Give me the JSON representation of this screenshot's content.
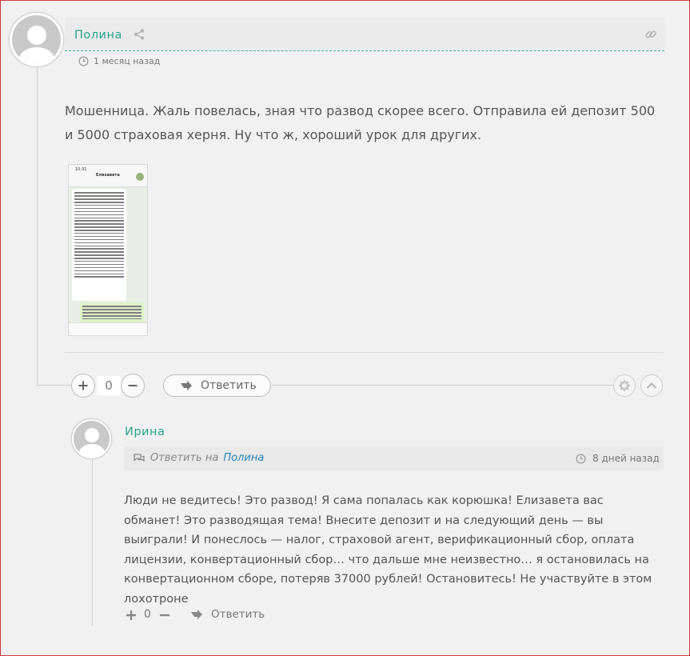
{
  "comments": [
    {
      "author": "Полина",
      "time": "1 месяц назад",
      "text": "Мошенница. Жаль повелась, зная что развод скорее всего. Отправила ей депозит 500 и 5000 страховая херня. Ну что ж, хороший урок для других.",
      "vote_count": "0",
      "reply_label": "Ответить",
      "attachment": {
        "status_time": "10:31",
        "contact_name": "Елизавета"
      }
    },
    {
      "author": "Ирина",
      "reply_to_prefix": "Ответить на",
      "reply_to_name": "Полина",
      "time": "8 дней назад",
      "text": "Люди не ведитесь! Это развод! Я сама попалась как корюшка! Елизавета вас обманет! Это разводящая тема! Внесите депозит и на следующий день — вы выиграли! И понеслось — налог, страховой агент, верификационный сбор, оплата лицензии, конвертационный сбор… что дальше мне неизвестно… я остановилась на конвертационном сборе, потеряв 37000 рублей! Остановитесь! Не участвуйте в этом лохотроне",
      "vote_count": "0",
      "reply_label": "Ответить"
    }
  ],
  "icons": {
    "share": "share-icon",
    "link": "link-icon",
    "clock": "clock-icon",
    "plus": "plus-icon",
    "minus": "minus-icon",
    "reply": "reply-arrow-icon",
    "gear": "gear-icon",
    "up": "chevron-up-icon",
    "reply_to": "comments-icon"
  },
  "colors": {
    "author": "#2aa58a",
    "link": "#2c83b8",
    "background": "#f1f1f1",
    "text": "#555555"
  }
}
